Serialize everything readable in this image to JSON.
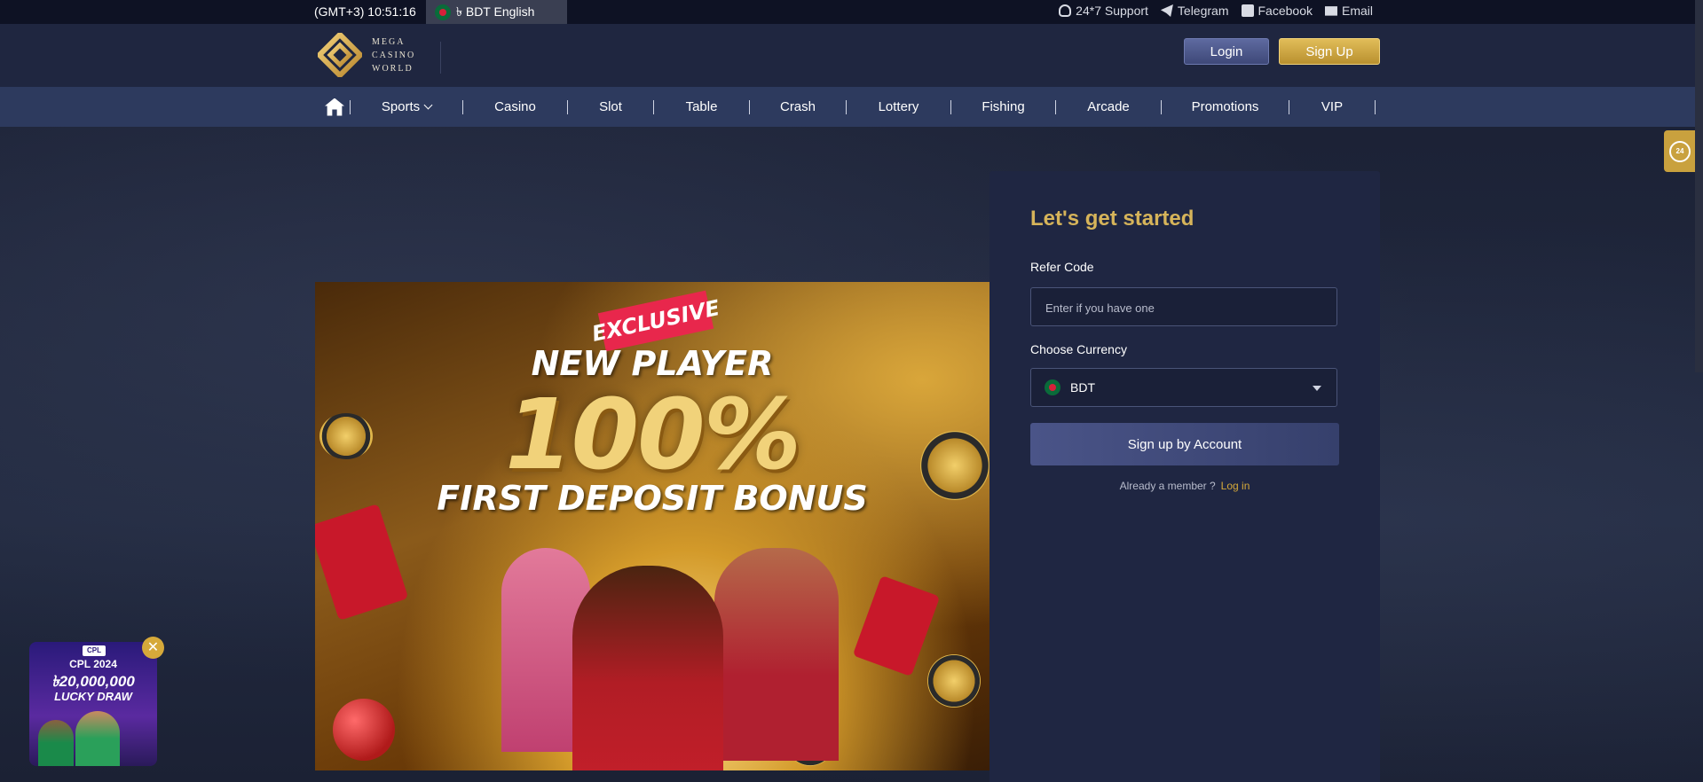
{
  "topbar": {
    "clock": "(GMT+3) 10:51:16",
    "language": "৳ BDT English",
    "links": [
      {
        "label": "24*7 Support",
        "icon": "headset-icon"
      },
      {
        "label": "Telegram",
        "icon": "telegram-icon"
      },
      {
        "label": "Facebook",
        "icon": "facebook-icon"
      },
      {
        "label": "Email",
        "icon": "email-icon"
      }
    ]
  },
  "header": {
    "logo_lines": [
      "MEGA",
      "CASINO",
      "WORLD"
    ],
    "login_label": "Login",
    "signup_label": "Sign Up"
  },
  "nav": {
    "items": [
      "Sports",
      "Casino",
      "Slot",
      "Table",
      "Crash",
      "Lottery",
      "Fishing",
      "Arcade",
      "Promotions",
      "VIP"
    ]
  },
  "banner": {
    "ribbon": "EXCLUSIVE",
    "line1": "NEW PLAYER",
    "line2": "100%",
    "line3": "FIRST DEPOSIT BONUS"
  },
  "signup": {
    "title": "Let's get started",
    "refer_label": "Refer Code",
    "refer_placeholder": "Enter if you have one",
    "currency_label": "Choose Currency",
    "currency_value": "BDT",
    "submit_label": "Sign up by Account",
    "member_text": "Already a member ?",
    "login_link": "Log in"
  },
  "float": {
    "support_badge": "24"
  },
  "promo": {
    "badge": "CPL",
    "line1": "CPL 2024",
    "line2": "৳20,000,000",
    "line3": "LUCKY DRAW",
    "close": "✕"
  },
  "colors": {
    "accent_gold": "#d6b45a",
    "nav_bg": "#2d3a5e",
    "panel_bg": "#1f2642"
  }
}
